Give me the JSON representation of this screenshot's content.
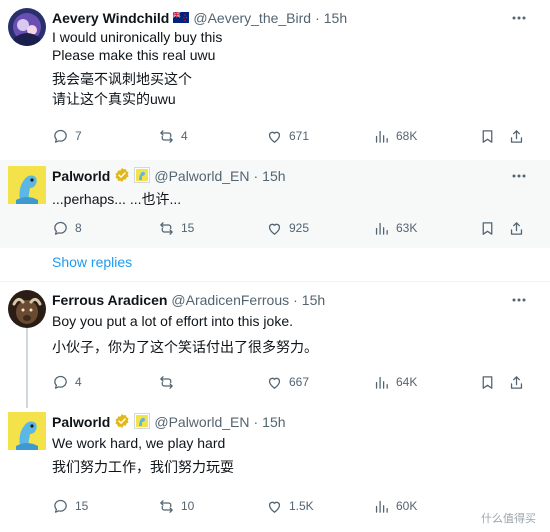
{
  "tweets": [
    {
      "name": "Aevery Windchild",
      "flag": "🇳🇿",
      "handle": "@Aevery_the_Bird",
      "time": "15h",
      "lines": [
        "I would unironically buy this",
        "Please make this real uwu",
        "我会毫不讽刺地买这个",
        "请让这个真实的uwu"
      ],
      "stats": {
        "replies": "7",
        "retweets": "4",
        "likes": "671",
        "views": "68K"
      }
    },
    {
      "name": "Palworld",
      "handle": "@Palworld_EN",
      "time": "15h",
      "lines": [
        "...perhaps... ...也许..."
      ],
      "stats": {
        "replies": "8",
        "retweets": "15",
        "likes": "925",
        "views": "63K"
      }
    },
    {
      "name": "Ferrous Aradicen",
      "handle": "@AradicenFerrous",
      "time": "15h",
      "lines": [
        "Boy you put a lot of effort into this joke.",
        "小伙子，你为了这个笑话付出了很多努力。"
      ],
      "stats": {
        "replies": "4",
        "retweets": "",
        "likes": "667",
        "views": "64K"
      }
    },
    {
      "name": "Palworld",
      "handle": "@Palworld_EN",
      "time": "15h",
      "lines": [
        "We work hard, we play hard",
        "我们努力工作，我们努力玩耍"
      ],
      "stats": {
        "replies": "15",
        "retweets": "10",
        "likes": "1.5K",
        "views": "60K"
      }
    }
  ],
  "show_replies": "Show replies",
  "watermark": "什么值得买",
  "colors": {
    "accent": "#1d9bf0",
    "muted": "#536471",
    "verified_gold": "#e2b719",
    "highlight_bg": "#f7f9f9"
  },
  "icons": [
    "reply-icon",
    "retweet-icon",
    "like-icon",
    "views-icon",
    "bookmark-icon",
    "share-icon",
    "more-icon",
    "verified-badge-icon",
    "affiliate-badge-icon"
  ]
}
